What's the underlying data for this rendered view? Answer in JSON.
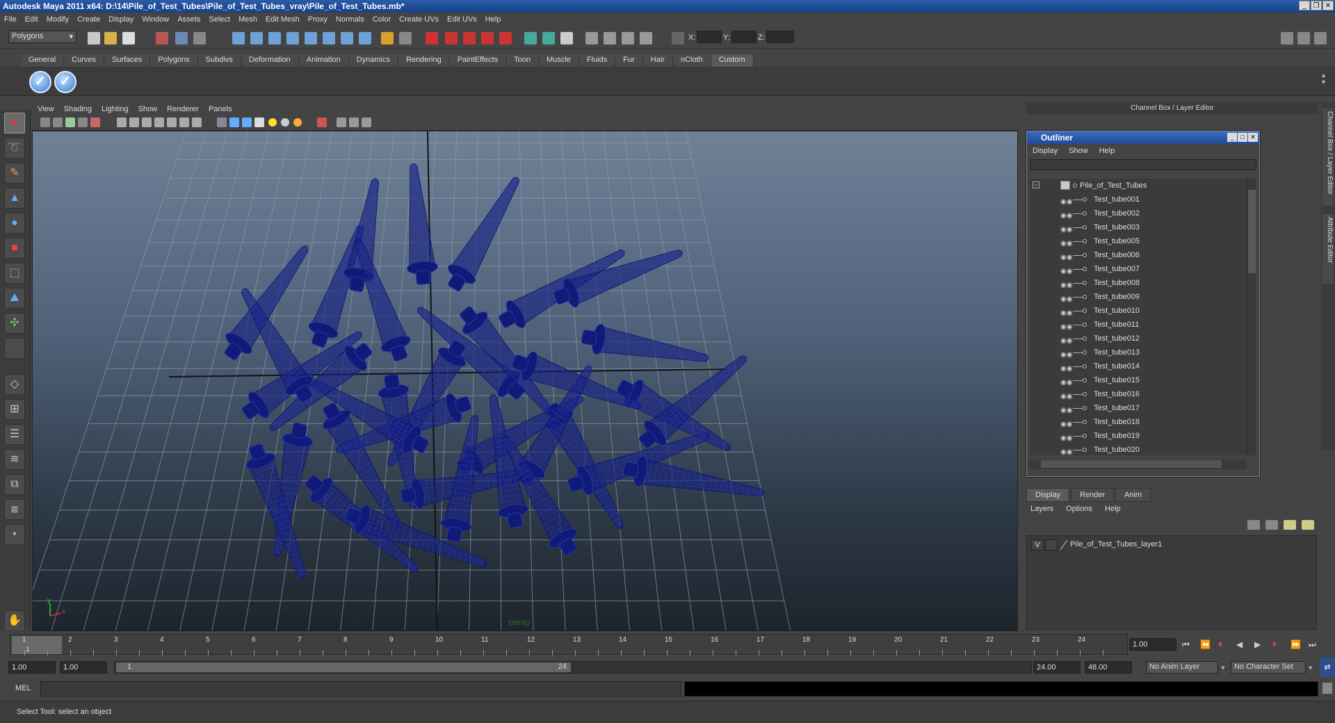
{
  "window": {
    "title": "Autodesk Maya 2011 x64: D:\\14\\Pile_of_Test_Tubes\\Pile_of_Test_Tubes_vray\\Pile_of_Test_Tubes.mb*"
  },
  "menubar": [
    "File",
    "Edit",
    "Modify",
    "Create",
    "Display",
    "Window",
    "Assets",
    "Select",
    "Mesh",
    "Edit Mesh",
    "Proxy",
    "Normals",
    "Color",
    "Create UVs",
    "Edit UVs",
    "Help"
  ],
  "statusline": {
    "mode": "Polygons",
    "x_label": "X:",
    "y_label": "Y:",
    "z_label": "Z:"
  },
  "shelf": {
    "tabs": [
      "General",
      "Curves",
      "Surfaces",
      "Polygons",
      "Subdivs",
      "Deformation",
      "Animation",
      "Dynamics",
      "Rendering",
      "PaintEffects",
      "Toon",
      "Muscle",
      "Fluids",
      "Fur",
      "Hair",
      "nCloth",
      "Custom"
    ],
    "active_tab": "Custom"
  },
  "panel": {
    "menu": [
      "View",
      "Shading",
      "Lighting",
      "Show",
      "Renderer",
      "Panels"
    ],
    "camera_label": "persp"
  },
  "channel_box": {
    "title": "Channel Box / Layer Editor"
  },
  "outliner": {
    "title": "Outliner",
    "menu": [
      "Display",
      "Show",
      "Help"
    ],
    "root": "Pile_of_Test_Tubes",
    "items": [
      "Test_tube001",
      "Test_tube002",
      "Test_tube003",
      "Test_tube005",
      "Test_tube006",
      "Test_tube007",
      "Test_tube008",
      "Test_tube009",
      "Test_tube010",
      "Test_tube011",
      "Test_tube012",
      "Test_tube013",
      "Test_tube014",
      "Test_tube015",
      "Test_tube016",
      "Test_tube017",
      "Test_tube018",
      "Test_tube019",
      "Test_tube020"
    ]
  },
  "side_tabs": {
    "channel_box": "Channel Box / Layer Editor",
    "attribute_editor": "Attribute Editor"
  },
  "layer_editor": {
    "tabs": [
      "Display",
      "Render",
      "Anim"
    ],
    "active_tab": "Display",
    "menu": [
      "Layers",
      "Options",
      "Help"
    ],
    "layer": {
      "visibility": "V",
      "name": "Pile_of_Test_Tubes_layer1"
    }
  },
  "timeline": {
    "frames": [
      "1",
      "2",
      "3",
      "4",
      "5",
      "6",
      "7",
      "8",
      "9",
      "10",
      "11",
      "12",
      "13",
      "14",
      "15",
      "16",
      "17",
      "18",
      "19",
      "20",
      "21",
      "22",
      "23",
      "24"
    ],
    "current_frame_marker": "1",
    "current_time": "1.00"
  },
  "range": {
    "start": "1.00",
    "playback_start": "1.00",
    "slider_start": "1",
    "slider_end": "24",
    "playback_end": "24.00",
    "end": "48.00",
    "anim_layer": "No Anim Layer",
    "character_set": "No Character Set"
  },
  "command_line": {
    "label": "MEL"
  },
  "help_line": {
    "text": "Select Tool: select an object"
  },
  "colors": {
    "accent": "#1f4a98",
    "wireframe": "#101a78",
    "viewport_top": "#6e8197",
    "viewport_bottom": "#1d242c"
  }
}
